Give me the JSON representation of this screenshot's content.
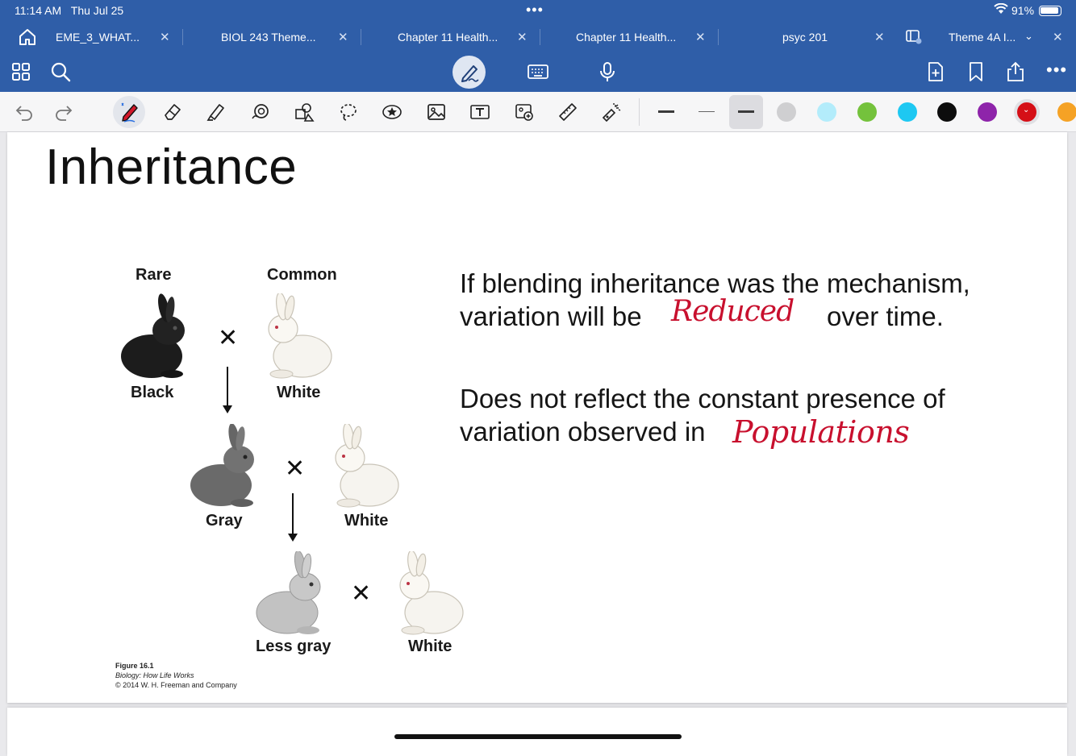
{
  "status": {
    "time": "11:14 AM",
    "date": "Thu Jul 25",
    "battery": "91%"
  },
  "tabs": [
    {
      "label": "EME_3_WHAT...",
      "active": false
    },
    {
      "label": "BIOL 243 Theme...",
      "active": false
    },
    {
      "label": "Chapter 11 Health...",
      "active": false
    },
    {
      "label": "Chapter 11 Health...",
      "active": false
    },
    {
      "label": "psyc 201",
      "active": false
    },
    {
      "label": "Theme 4A I...",
      "active": true
    }
  ],
  "toolbar": {
    "icons": [
      "grid-icon",
      "search-icon",
      "pen-mode-icon",
      "keyboard-icon",
      "microphone-icon",
      "add-page-icon",
      "bookmark-icon",
      "share-icon",
      "more-icon"
    ]
  },
  "tools": [
    "pen-icon",
    "eraser-icon",
    "highlighter-icon",
    "shape-icon",
    "elements-icon",
    "lasso-icon",
    "sticker-icon",
    "image-icon",
    "text-box-icon",
    "camera-icon",
    "ruler-icon",
    "laser-pointer-icon"
  ],
  "colors": [
    "#cfcfd1",
    "#b3ecfb",
    "#74c23c",
    "#1ec8f2",
    "#0d0d0d",
    "#8e24aa",
    "#d50f17",
    "#f5a225"
  ],
  "note": {
    "title": "Inheritance",
    "figure": {
      "rare": "Rare",
      "common": "Common",
      "black": "Black",
      "white1": "White",
      "gray": "Gray",
      "white2": "White",
      "less_gray": "Less gray",
      "white3": "White",
      "credit_fig": "Figure 16.1",
      "credit_book": "Biology: How Life Works",
      "credit_copy": "© 2014 W. H. Freeman and Company"
    },
    "line1": "If blending inheritance was the mechanism,",
    "line2_a": "variation will be",
    "line2_hand": "Reduced",
    "line2_b": "over time.",
    "line3": "Does not reflect the constant presence of",
    "line4_a": "variation observed in",
    "line4_hand": "Populations"
  }
}
